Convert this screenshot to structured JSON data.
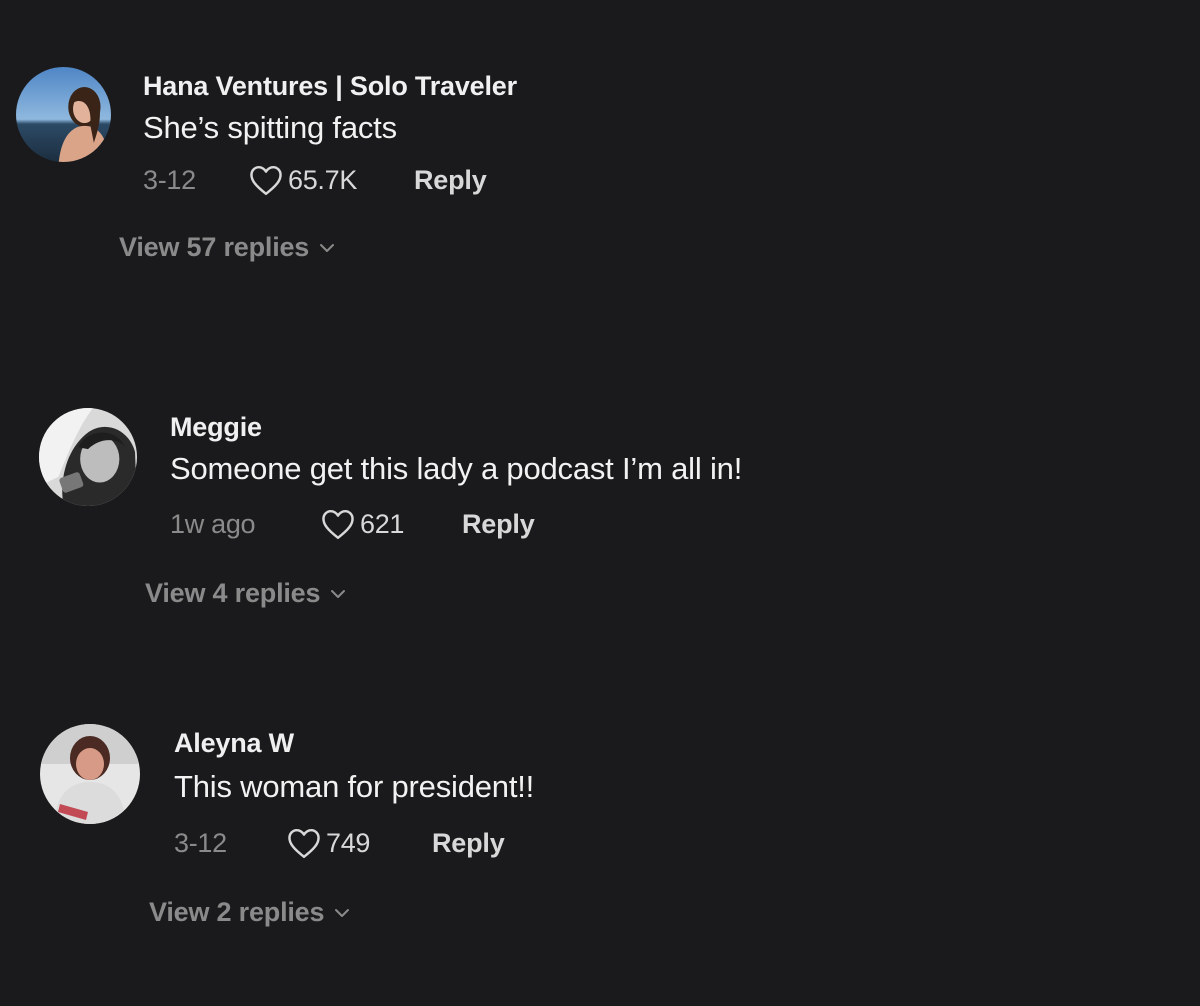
{
  "comments": [
    {
      "username": "Hana Ventures | Solo Traveler",
      "text": "She’s spitting facts",
      "date": "3-12",
      "likes": "65.7K",
      "reply_label": "Reply",
      "view_replies_label": "View 57 replies"
    },
    {
      "username": "Meggie",
      "text": "Someone get this lady a podcast I’m all in!",
      "date": "1w ago",
      "likes": "621",
      "reply_label": "Reply",
      "view_replies_label": "View 4 replies"
    },
    {
      "username": "Aleyna W",
      "text": "This woman for president!!",
      "date": "3-12",
      "likes": "749",
      "reply_label": "Reply",
      "view_replies_label": "View 2 replies"
    }
  ],
  "icons": {
    "like": "heart-outline-icon",
    "expand": "chevron-down-icon"
  },
  "colors": {
    "background": "#1a1a1c",
    "primary_text": "#f2f2f2",
    "secondary_text": "#8a8a8a"
  }
}
